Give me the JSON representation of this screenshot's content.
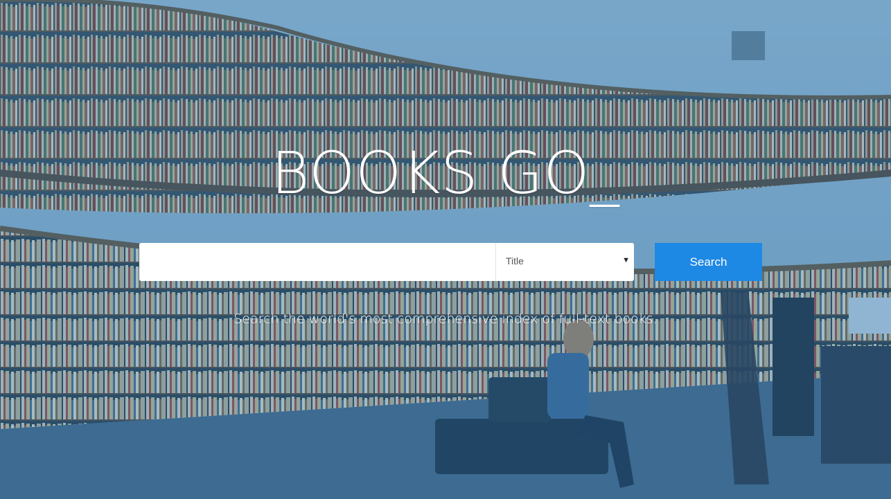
{
  "brand": {
    "title": "BOOKS GO_"
  },
  "search": {
    "input_value": "",
    "placeholder": "",
    "select": {
      "selected": "Title"
    },
    "button_label": "Search"
  },
  "tagline": "Search the world's most comprehensive index of full-text books.",
  "colors": {
    "accent": "#1e88e5",
    "overlay": "#3a7fb5",
    "text": "#ffffff"
  },
  "icons": {
    "select_caret": "caret-down-icon"
  }
}
